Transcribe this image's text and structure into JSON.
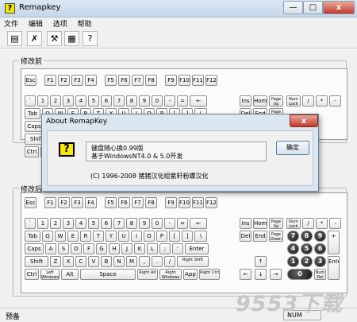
{
  "window": {
    "title": "Remapkey",
    "icon_glyph": "?",
    "minimize_glyph": "—",
    "maximize_glyph": "□",
    "close_glyph": "x"
  },
  "menu": [
    "文件",
    "编辑",
    "选项",
    "帮助"
  ],
  "toolbar": {
    "icons": [
      "open-icon",
      "save-icon",
      "remap-icon",
      "reset-icon",
      "help-icon"
    ],
    "glyphs": [
      "▤",
      "✗",
      "⚒",
      "▦",
      "?"
    ]
  },
  "groups": {
    "before": "修改前",
    "after": "修改后"
  },
  "keyboard_rows": {
    "function": [
      "Esc",
      "F1",
      "F2",
      "F3",
      "F4",
      "F5",
      "F6",
      "F7",
      "F8",
      "F9",
      "F10",
      "F11",
      "F12"
    ],
    "number": [
      "`",
      "1",
      "2",
      "3",
      "4",
      "5",
      "6",
      "7",
      "8",
      "9",
      "0",
      "-",
      "=",
      "←"
    ],
    "qwerty": [
      "Tab",
      "Q",
      "W",
      "E",
      "R",
      "T",
      "Y",
      "U",
      "I",
      "O",
      "P",
      "[",
      "]",
      "\\"
    ],
    "asdf": [
      "Caps",
      "A",
      "S",
      "D",
      "F",
      "G",
      "H",
      "J",
      "K",
      "L",
      ";",
      "'",
      "Enter"
    ],
    "zxcv": [
      "Shift",
      "Z",
      "X",
      "C",
      "V",
      "B",
      "N",
      "M",
      ",",
      ".",
      "/",
      "Right Shift"
    ],
    "bottom": [
      "Ctrl",
      "Left Windows",
      "Alt",
      "Space",
      "Right Alt",
      "Right Windows",
      "App",
      "Right Ctrl"
    ],
    "nav_top": [
      "Ins",
      "Home",
      "Page Up"
    ],
    "nav_bottom": [
      "Del",
      "End",
      "Page Down"
    ],
    "numpad_top": [
      "Num Lock",
      "/",
      "*",
      "-"
    ],
    "arrows": [
      "↑",
      "←",
      "↓",
      "→"
    ],
    "numpad_digits": [
      "7",
      "8",
      "9",
      "4",
      "5",
      "6",
      "1",
      "2",
      "3",
      "0"
    ],
    "numpad_other": [
      "+",
      "Enter",
      "Num Del"
    ]
  },
  "dialog": {
    "title": "About RemapKey",
    "close_glyph": "x",
    "icon_glyph": "?",
    "line1": "键盘随心换0.99版",
    "line2": "基于WindowsNT4.0 & 5.0开发",
    "copyright": "(C) 1996-2008 猪猪汉化组紫轩粉蝶汉化",
    "ok": "确定"
  },
  "status": {
    "left": "预备",
    "num": "NUM"
  },
  "watermark": "9553下载"
}
